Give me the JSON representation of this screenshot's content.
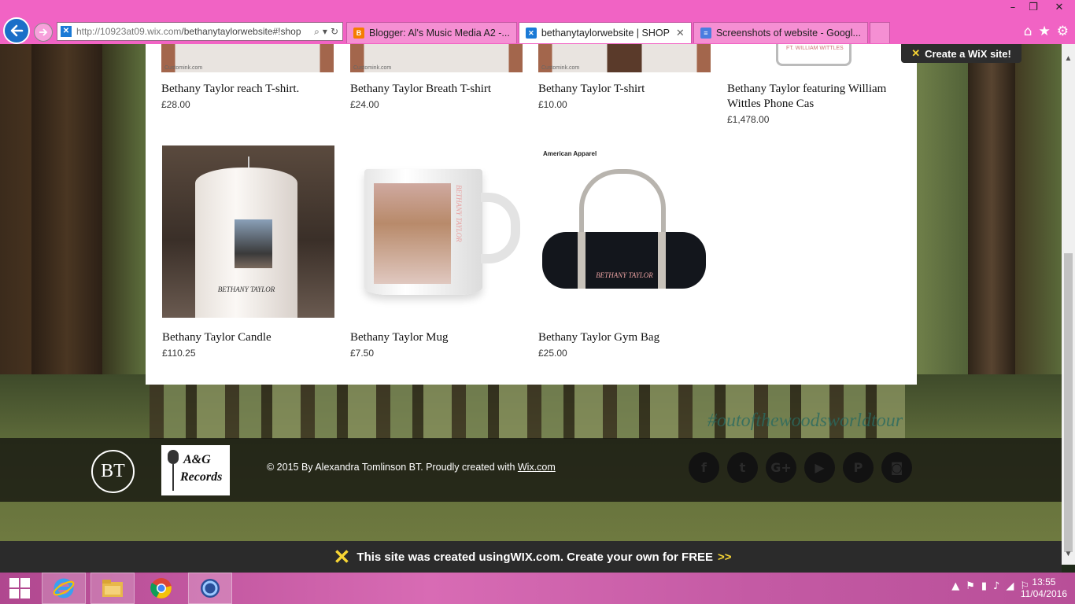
{
  "browser": {
    "url": "http://10923at09.wix.com/bethanytaylorwebsite#!shop",
    "url_host": "http://10923at09.wix.com",
    "url_path": "/bethanytaylorwebsite#!shop",
    "tabs": [
      {
        "label": "Blogger: Al's Music Media A2 -...",
        "icon": "blogger-icon",
        "active": false
      },
      {
        "label": "bethanytaylorwebsite | SHOP",
        "icon": "wix-icon",
        "active": true
      },
      {
        "label": "Screenshots of website - Googl...",
        "icon": "google-docs-icon",
        "active": false
      }
    ]
  },
  "shop": {
    "top_row": [
      {
        "name": "Bethany Taylor reach T-shirt.",
        "price": "£28.00"
      },
      {
        "name": "Bethany Taylor Breath T-shirt",
        "price": "£24.00"
      },
      {
        "name": "Bethany Taylor T-shirt",
        "price": "£10.00"
      },
      {
        "name": "Bethany Taylor featuring William Wittles Phone Cas",
        "price": "£1,478.00"
      }
    ],
    "bottom_row": [
      {
        "name": "Bethany Taylor Candle",
        "price": "£110.25"
      },
      {
        "name": "Bethany Taylor Mug",
        "price": "£7.50"
      },
      {
        "name": "Bethany Taylor Gym Bag",
        "price": "£25.00"
      }
    ],
    "thumb_watermark": "Customink.com",
    "phone_case_text": "FT. WILLIAM WITTLES",
    "product_label": "BETHANY TAYLOR",
    "bag_brand": "American Apparel"
  },
  "footer": {
    "logo_initials": "BT",
    "label_logo_line1": "A&G",
    "label_logo_line2": "Records",
    "copyright_prefix": "© 2015 By Alexandra Tomlinson BT. Proudly created with ",
    "copyright_link": "Wix.com",
    "hashtag": "#outofthewoodsworldtour",
    "social": [
      {
        "icon": "facebook-icon",
        "glyph": "f"
      },
      {
        "icon": "twitter-icon",
        "glyph": "t"
      },
      {
        "icon": "google-plus-icon",
        "glyph": "G+"
      },
      {
        "icon": "youtube-icon",
        "glyph": "▶"
      },
      {
        "icon": "pinterest-icon",
        "glyph": "P"
      },
      {
        "icon": "instagram-icon",
        "glyph": "◙"
      }
    ]
  },
  "wix": {
    "badge": "Create a WiX site!",
    "banner_prefix": "This site was created using ",
    "banner_brand": "WIX.com",
    "banner_suffix": ". Create your own for FREE ",
    "banner_arrow": ">>"
  },
  "taskbar": {
    "time": "13:55",
    "date": "11/04/2016"
  },
  "colors": {
    "chrome_pink": "#f163c4",
    "wix_yellow": "#f7d534"
  }
}
